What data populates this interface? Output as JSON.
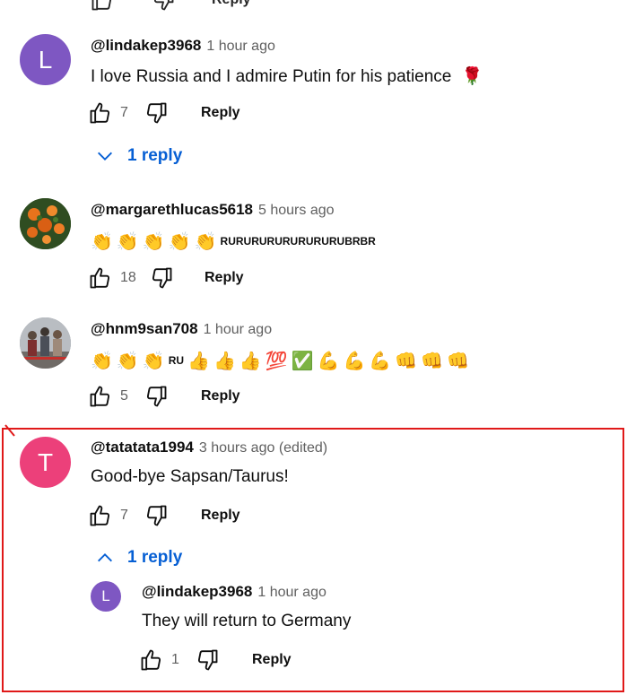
{
  "colors": {
    "link_blue": "#065fd4",
    "highlight_red": "#e01919",
    "secondary_text": "#606060"
  },
  "top_partial": {
    "reply_label": "Reply"
  },
  "comments": [
    {
      "author": "@lindakep3968",
      "time": "1 hour ago",
      "avatar_letter": "L",
      "avatar_color": "#7e57c2",
      "text": "I love Russia and I admire Putin for his patience",
      "emoji": "🌹",
      "likes": "7",
      "reply_label": "Reply",
      "replies_toggle": "1 reply"
    },
    {
      "author": "@margarethlucas5618",
      "time": "5 hours ago",
      "emoji_text": "RURURURURURURURUBRBR",
      "likes": "18",
      "reply_label": "Reply"
    },
    {
      "author": "@hnm9san708",
      "time": "1 hour ago",
      "inline_text": "RU",
      "likes": "5",
      "reply_label": "Reply"
    },
    {
      "author": "@tatatata1994",
      "time": "3 hours ago (edited)",
      "avatar_letter": "T",
      "avatar_color": "#ec407a",
      "text": "Good-bye Sapsan/Taurus!",
      "likes": "7",
      "reply_label": "Reply",
      "replies_toggle": "1 reply",
      "reply": {
        "author": "@lindakep3968",
        "time": "1 hour ago",
        "avatar_letter": "L",
        "avatar_color": "#7e57c2",
        "text": "They will return to Germany",
        "likes": "1",
        "reply_label": "Reply"
      }
    }
  ]
}
